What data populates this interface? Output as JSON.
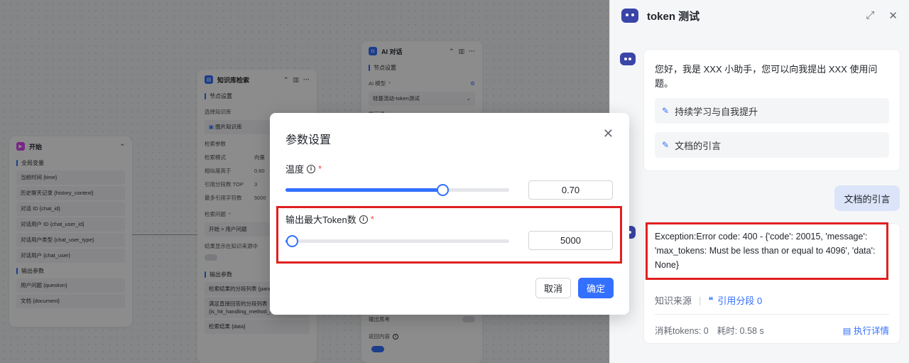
{
  "workflow": {
    "start_node": {
      "title": "开始",
      "globals_title": "全局变量",
      "globals": [
        "当前时间 {time}",
        "历史聊天记录 {history_context}",
        "对话 ID {chat_id}",
        "对话用户 ID {chat_user_id}",
        "对话用户类型 {chat_user_type}",
        "对话用户 {chat_user}"
      ],
      "output_title": "输出参数",
      "outputs": [
        "用户问题 {question}",
        "文档 {document}"
      ]
    },
    "kb_node": {
      "title": "知识库检索",
      "settings_title": "节点设置",
      "select_kb_label": "选择知识库",
      "kb_name": "图片知识库",
      "params_label": "检索参数",
      "params": [
        {
          "k": "检索模式",
          "v": "向量"
        },
        {
          "k": "相似度高于",
          "v": "0.60"
        },
        {
          "k": "引用分段数 TOP",
          "v": "3"
        },
        {
          "k": "最多引用字符数",
          "v": "5000"
        }
      ],
      "question_label": "检索问题",
      "question_value": "开始 > 用户问题",
      "show_source_label": "结果显示在知识来源中",
      "output_title": "输出参数",
      "outputs": [
        "检索结果的分段列表 {paragraph_list}",
        "满足直接回答的分段列表 {is_hit_handling_method_list}",
        "检索结果 {data}"
      ]
    },
    "ai_node": {
      "title": "AI 对话",
      "settings_title": "节点设置",
      "model_label": "AI 模型",
      "model_value": "硅基流动-token测试",
      "cut_label": "提示词",
      "output_think_label": "输出思考",
      "return_content_label": "返回内容"
    }
  },
  "modal": {
    "title": "参数设置",
    "temperature": {
      "label": "温度",
      "value": "0.70",
      "fraction": 0.7
    },
    "max_tokens": {
      "label": "输出最大Token数",
      "value": "5000",
      "fraction": 0.03
    },
    "cancel_label": "取消",
    "confirm_label": "确定"
  },
  "panel": {
    "title": "token 测试",
    "greeting": "您好，我是 XXX 小助手，您可以向我提出 XXX 使用问题。",
    "suggestions": [
      "持续学习与自我提升",
      "文档的引言"
    ],
    "user_message": "文档的引言",
    "error": "Exception:Error code: 400 - {'code': 20015, 'message': 'max_tokens: Must be less than or equal to 4096', 'data': None}",
    "source_label": "知识来源",
    "cite_label": "引用分段 0",
    "tokens_label": "消耗tokens: 0",
    "time_label": "耗时: 0.58 s",
    "detail_label": "执行详情"
  },
  "colors": {
    "accent": "#3370ff",
    "highlight": "#e02020",
    "bot": "#3a45a8"
  }
}
